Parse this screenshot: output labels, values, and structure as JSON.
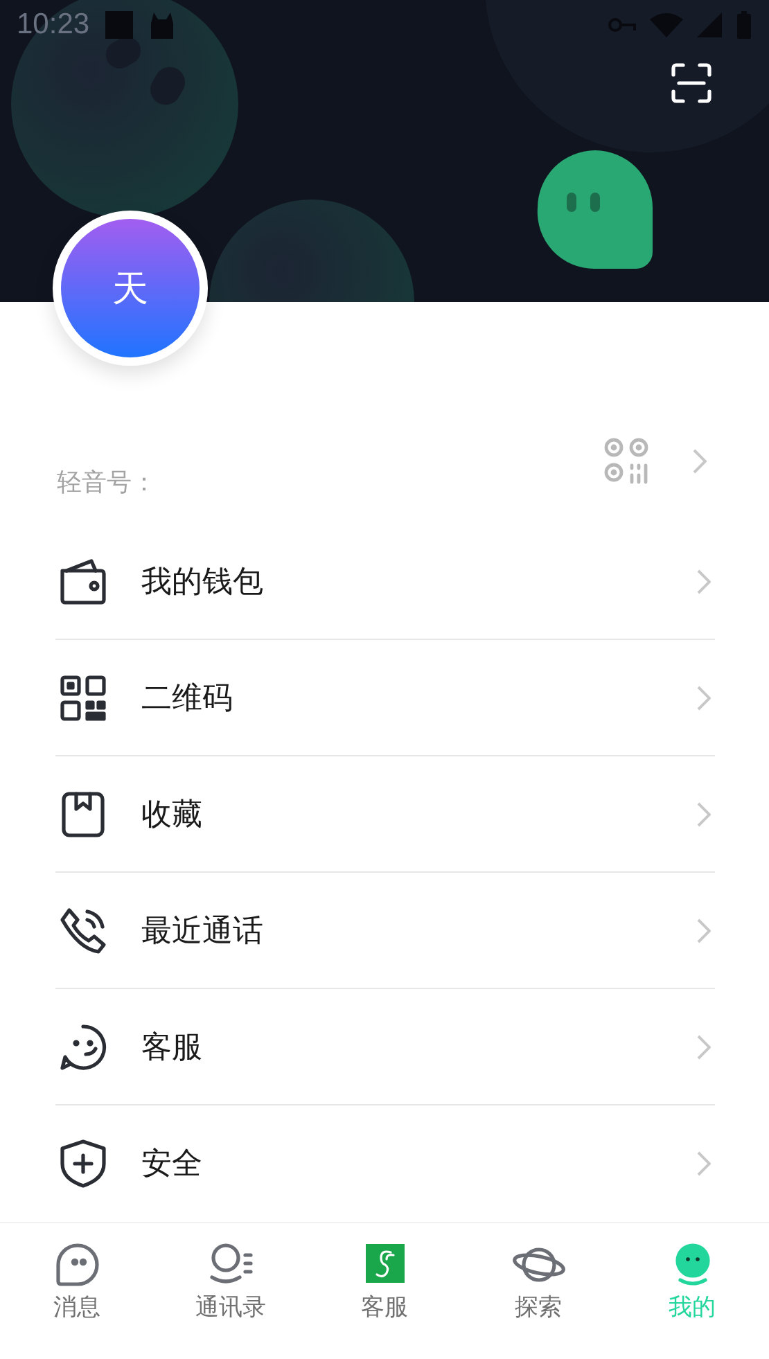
{
  "status_bar": {
    "time": "10:23"
  },
  "profile": {
    "avatar_text": "天",
    "id_label": "轻音号："
  },
  "menu": [
    {
      "kind": "wallet",
      "label": "我的钱包"
    },
    {
      "kind": "qrcode",
      "label": "二维码"
    },
    {
      "kind": "bookmark",
      "label": "收藏"
    },
    {
      "kind": "phone",
      "label": "最近通话"
    },
    {
      "kind": "support",
      "label": "客服"
    },
    {
      "kind": "shield",
      "label": "安全"
    }
  ],
  "tabs": [
    {
      "kind": "messages",
      "label": "消息",
      "selected": false
    },
    {
      "kind": "contacts",
      "label": "通讯录",
      "selected": false
    },
    {
      "kind": "service",
      "label": "客服",
      "selected": false
    },
    {
      "kind": "explore",
      "label": "探索",
      "selected": false
    },
    {
      "kind": "me",
      "label": "我的",
      "selected": true
    }
  ]
}
